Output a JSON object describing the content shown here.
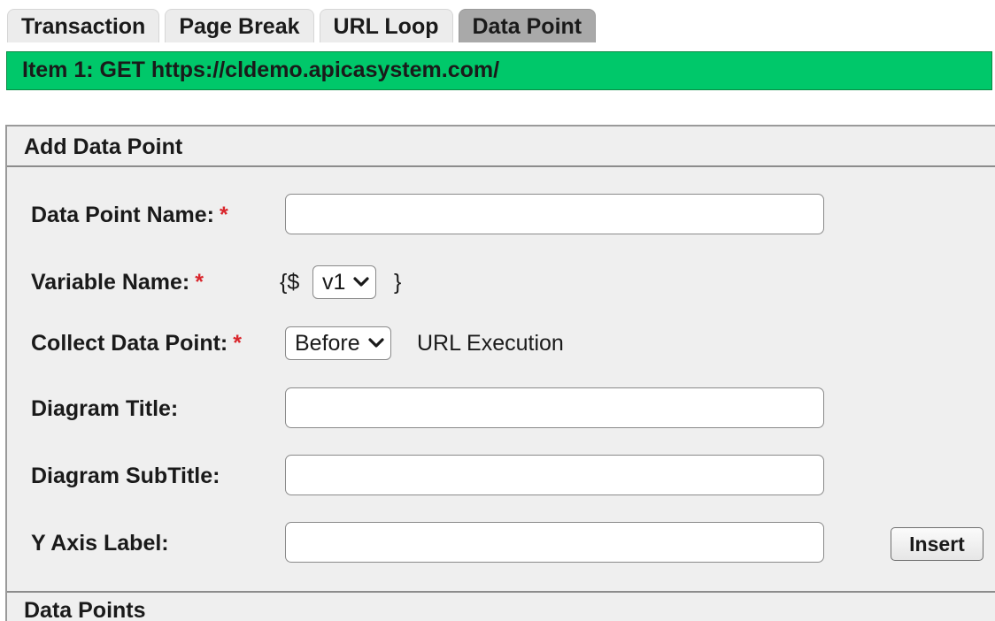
{
  "tabs": [
    {
      "label": "Transaction",
      "active": false
    },
    {
      "label": "Page Break",
      "active": false
    },
    {
      "label": "URL Loop",
      "active": false
    },
    {
      "label": "Data Point",
      "active": true
    }
  ],
  "item_bar": {
    "text": "Item 1:  GET https://cldemo.apicasystem.com/",
    "color": "#00c86a"
  },
  "panel": {
    "title": "Add Data Point",
    "required_marker": "*",
    "fields": {
      "data_point_name": {
        "label": "Data Point Name:",
        "value": "",
        "required": true
      },
      "variable_name": {
        "label": "Variable Name:",
        "prefix": "{$",
        "selected": "v1",
        "suffix": "}",
        "required": true
      },
      "collect_data_point": {
        "label": "Collect Data Point:",
        "selected": "Before",
        "after_text": "URL Execution",
        "required": true
      },
      "diagram_title": {
        "label": "Diagram Title:",
        "value": ""
      },
      "diagram_subtitle": {
        "label": "Diagram SubTitle:",
        "value": ""
      },
      "y_axis_label": {
        "label": "Y Axis Label:",
        "value": ""
      }
    },
    "insert_button": "Insert"
  },
  "data_points_section": {
    "title": "Data Points"
  },
  "icons": {
    "dropdown": "chevron-down-icon"
  },
  "colors": {
    "required": "#d9262c",
    "active_tab": "#a9a9a9",
    "panel_bg": "#efefef"
  }
}
